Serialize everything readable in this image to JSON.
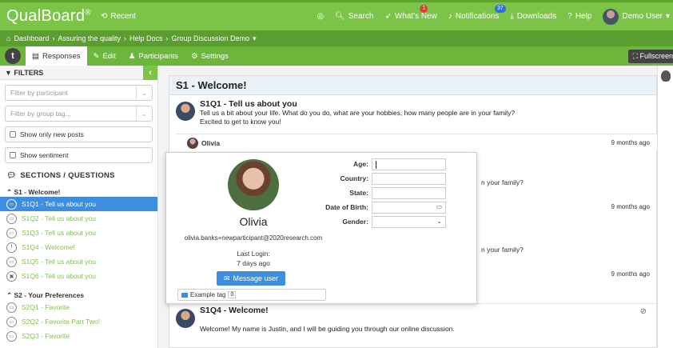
{
  "app": {
    "brand": "QualBoard",
    "brand_mark": "®",
    "recent": "Recent"
  },
  "topnav": {
    "search": "Search",
    "whats_new": "What's New",
    "whats_new_badge": "1",
    "notifications": "Notifications",
    "notifications_badge": "37",
    "downloads": "Downloads",
    "help": "Help",
    "user": "Demo User"
  },
  "breadcrumb": {
    "items": [
      "Dashboard",
      "Assuring the quality",
      "Help Docs",
      "Group Discussion Demo"
    ]
  },
  "subnav": {
    "badge": "t",
    "tabs": [
      "Responses",
      "Edit",
      "Participants",
      "Settings"
    ],
    "fullscreen": "Fullscreen"
  },
  "filters": {
    "title": "FILTERS",
    "participant_placeholder": "Filter by participant",
    "group_tag_placeholder": "Filter by group tag...",
    "only_new": "Show only new posts",
    "sentiment": "Show sentiment"
  },
  "sections": {
    "title": "SECTIONS / QUESTIONS",
    "groups": [
      {
        "name": "S1 - Welcome!",
        "items": [
          {
            "label": "S1Q1 - Tell us about you",
            "icon": "chat-icon",
            "active": true
          },
          {
            "label": "S1Q2 - Tell us about you",
            "icon": "chat-icon"
          },
          {
            "label": "S1Q3 - Tell us about you",
            "icon": "chat-icon"
          },
          {
            "label": "S1Q4 - Welcome!",
            "icon": "info-icon"
          },
          {
            "label": "S1Q5 - Tell us about you",
            "icon": "chat-icon"
          },
          {
            "label": "S1Q6 - Tell us about you",
            "icon": "image-icon"
          }
        ]
      },
      {
        "name": "S2 - Your Preferences",
        "items": [
          {
            "label": "S2Q1 - Favorite",
            "icon": "chat-icon"
          },
          {
            "label": "S2Q2 - Favorite Part Two!",
            "icon": "chat-icon"
          },
          {
            "label": "S2Q3 - Favorite",
            "icon": "chat-icon"
          }
        ]
      }
    ]
  },
  "main": {
    "section_title": "S1 - Welcome!",
    "q1": {
      "title": "S1Q1 - Tell us about you",
      "text": "Tell us a bit about your life. What do you do, what are your hobbies, how many people are in your family?",
      "text2": "Excited to get to know you!"
    },
    "replies": [
      {
        "name": "Olivia",
        "time": "9 months ago"
      },
      {
        "time": "9 months ago"
      },
      {
        "time": "9 months ago"
      }
    ],
    "partial_family": "n your family?",
    "q4": {
      "title": "S1Q4 - Welcome!",
      "text": "Welcome! My name is Justin, and I will be guiding you through our online discussion."
    }
  },
  "popup": {
    "name": "Olivia",
    "email": "olivia.banks+newparticipant@2020research.com",
    "last_login_label": "Last Login:",
    "last_login_value": "7 days ago",
    "message_button": "Message user",
    "tag_label": "Example tag",
    "tag_count": "0",
    "fields": {
      "age": "Age:",
      "country": "Country:",
      "state": "State:",
      "dob": "Date of Birth:",
      "gender": "Gender:"
    }
  }
}
